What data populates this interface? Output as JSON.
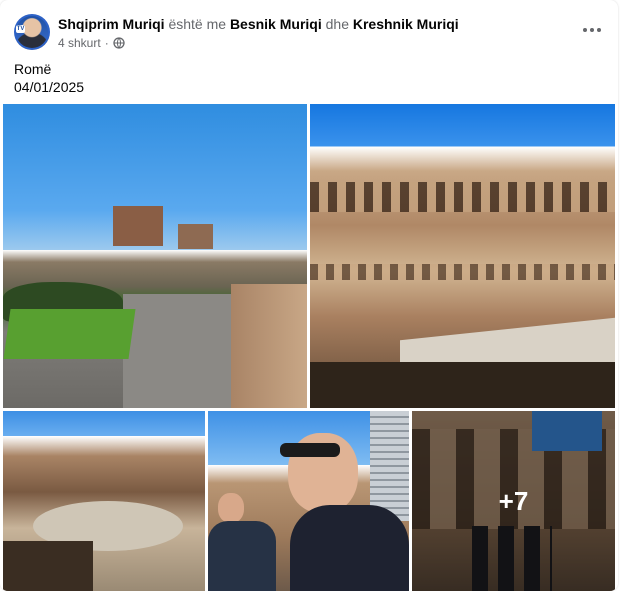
{
  "post": {
    "author": "Shqiprim Muriqi",
    "with_text": "është me",
    "tagged_1": "Besnik Muriqi",
    "and_text": "dhe",
    "tagged_2": "Kreshnik Muriqi",
    "time": "4 shkurt",
    "separator": "·",
    "privacy_icon": "globe-icon",
    "caption_line1": "Romë",
    "caption_line2": "04/01/2025",
    "more_photos": "+7"
  }
}
